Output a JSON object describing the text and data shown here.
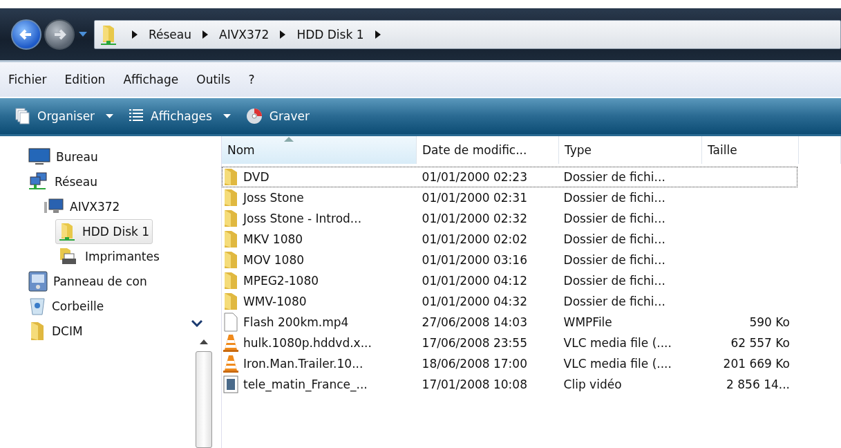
{
  "address_bar": {
    "segments": [
      "Réseau",
      "AIVX372",
      "HDD Disk 1"
    ]
  },
  "menu": [
    "Fichier",
    "Edition",
    "Affichage",
    "Outils",
    "?"
  ],
  "toolbar": [
    {
      "label": "Organiser",
      "kind": "organize"
    },
    {
      "label": "Affichages",
      "kind": "views"
    },
    {
      "label": "Graver",
      "kind": "burn"
    }
  ],
  "tree": [
    {
      "label": "Bureau",
      "kind": "desktop",
      "selected": false
    },
    {
      "label": "Réseau",
      "kind": "network",
      "selected": false,
      "children": [
        {
          "label": "AIVX372",
          "kind": "computer",
          "selected": false,
          "children": [
            {
              "label": "HDD Disk 1",
              "kind": "share",
              "selected": true
            },
            {
              "label": "Imprimantes",
              "kind": "printer",
              "selected": false
            }
          ]
        }
      ]
    },
    {
      "label": "Panneau de con",
      "kind": "control",
      "selected": false
    },
    {
      "label": "Corbeille",
      "kind": "bin",
      "selected": false
    },
    {
      "label": "DCIM",
      "kind": "folder",
      "selected": false
    }
  ],
  "table": {
    "columns": [
      {
        "label": "Nom",
        "sorted": true
      },
      {
        "label": "Date de modific...",
        "sorted": false
      },
      {
        "label": "Type",
        "sorted": false
      },
      {
        "label": "Taille",
        "sorted": false
      }
    ],
    "rows": [
      {
        "kind": "folder",
        "focused": true,
        "cells": [
          "DVD",
          "01/01/2000 02:23",
          "Dossier de fichi..."
        ]
      },
      {
        "kind": "folder",
        "focused": false,
        "cells": [
          "Joss Stone",
          "01/01/2000 02:31",
          "Dossier de fichi..."
        ]
      },
      {
        "kind": "folder",
        "focused": false,
        "cells": [
          "Joss Stone - Introd...",
          "01/01/2000 02:32",
          "Dossier de fichi..."
        ]
      },
      {
        "kind": "folder",
        "focused": false,
        "cells": [
          "MKV 1080",
          "01/01/2000 02:02",
          "Dossier de fichi..."
        ]
      },
      {
        "kind": "folder",
        "focused": false,
        "cells": [
          "MOV 1080",
          "01/01/2000 03:16",
          "Dossier de fichi..."
        ]
      },
      {
        "kind": "folder",
        "focused": false,
        "cells": [
          "MPEG2-1080",
          "01/01/2000 04:12",
          "Dossier de fichi..."
        ]
      },
      {
        "kind": "folder",
        "focused": false,
        "cells": [
          "WMV-1080",
          "01/01/2000 04:32",
          "Dossier de fichi..."
        ]
      },
      {
        "kind": "file",
        "focused": false,
        "cells": [
          "Flash 200km.mp4",
          "27/06/2008 14:03",
          "WMPFile",
          "590 Ko"
        ]
      },
      {
        "kind": "vlc",
        "focused": false,
        "cells": [
          "hulk.1080p.hddvd.x...",
          "17/06/2008 23:55",
          "VLC media file (....",
          "62 557 Ko"
        ]
      },
      {
        "kind": "vlc",
        "focused": false,
        "cells": [
          "Iron.Man.Trailer.10...",
          "18/06/2008 17:00",
          "VLC media file (....",
          "201 669 Ko"
        ]
      },
      {
        "kind": "video",
        "focused": false,
        "cells": [
          "tele_matin_France_...",
          "17/01/2008 10:08",
          "Clip vidéo",
          "2 856 14..."
        ]
      }
    ]
  }
}
